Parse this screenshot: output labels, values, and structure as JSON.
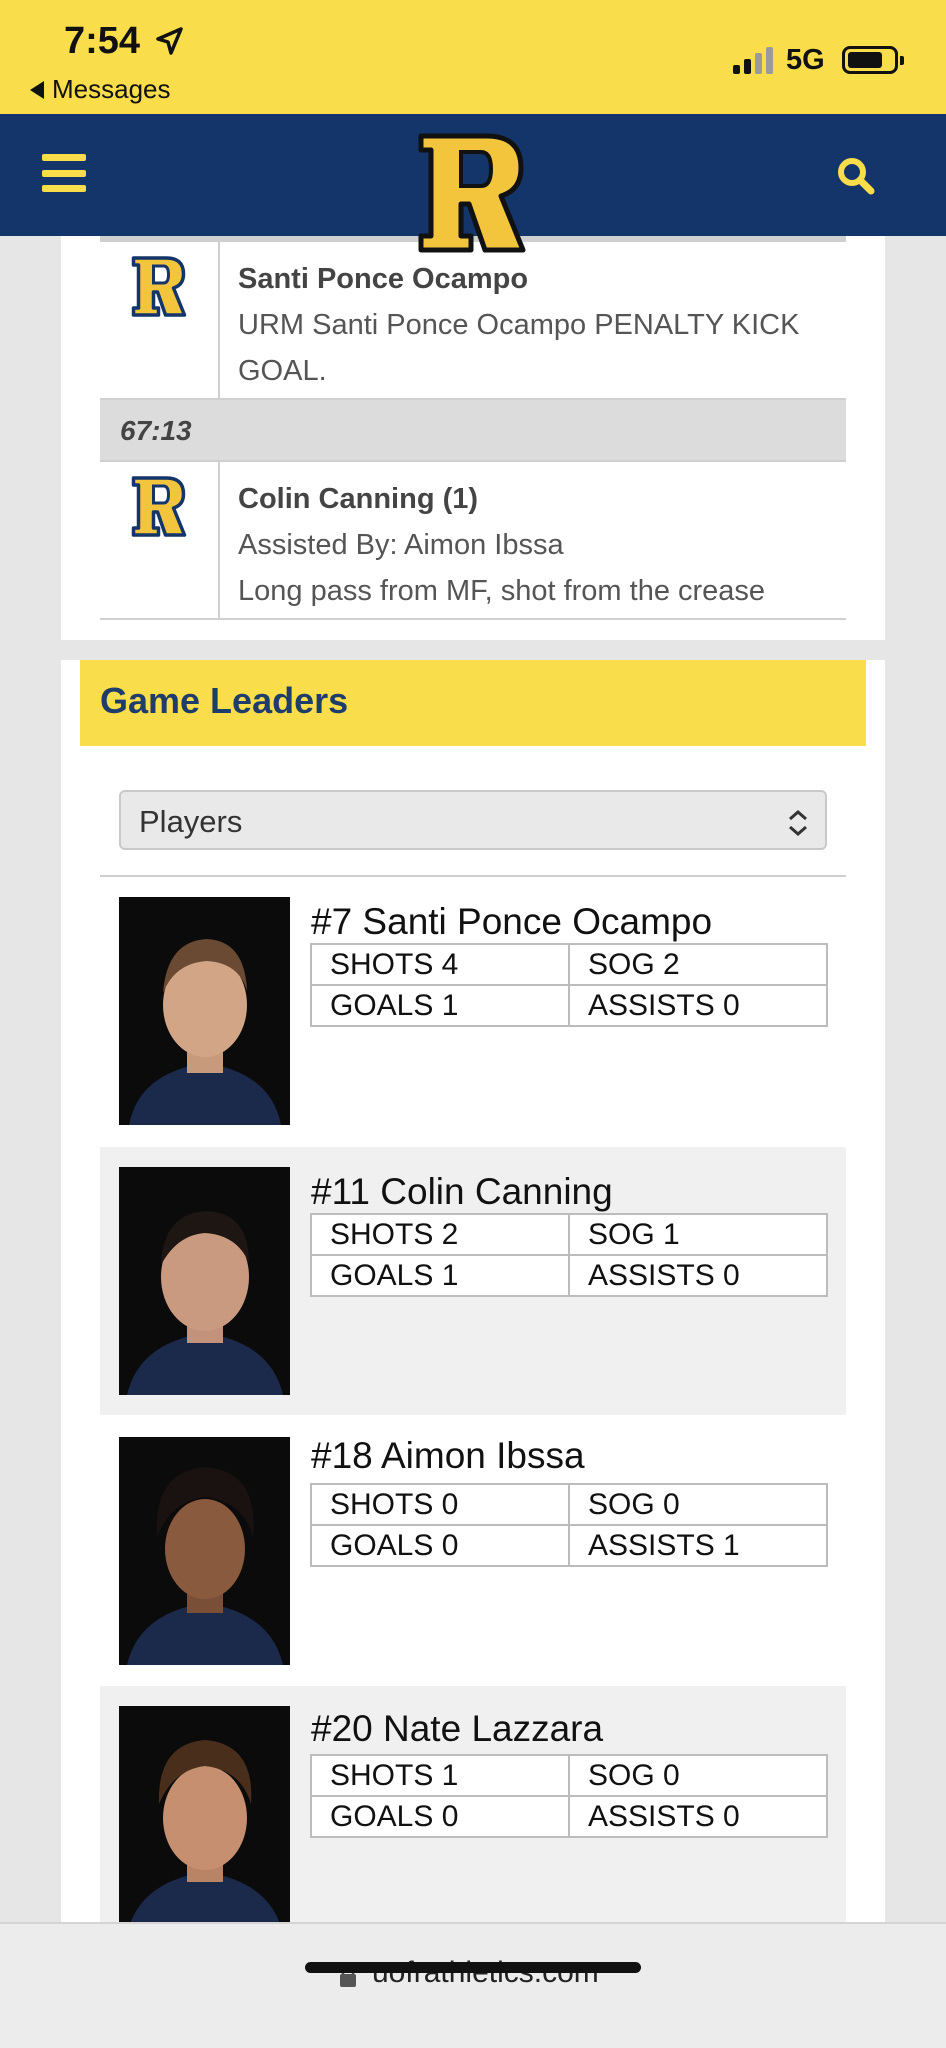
{
  "status_bar": {
    "time": "7:54",
    "back_label": "Messages",
    "network": "5G"
  },
  "header": {
    "logo_letter": "R"
  },
  "events": [
    {
      "player": "Santi Ponce Ocampo",
      "lines": [
        "URM Santi Ponce Ocampo PENALTY KICK",
        "GOAL."
      ]
    },
    {
      "time": "67:13",
      "player": "Colin Canning (1)",
      "lines": [
        "Assisted By: Aimon Ibssa",
        "Long pass from MF, shot from the crease"
      ]
    }
  ],
  "leaders": {
    "title": "Game Leaders",
    "select_value": "Players",
    "players": [
      {
        "name": "#7 Santi Ponce Ocampo",
        "shots": "SHOTS 4",
        "sog": "SOG 2",
        "goals": "GOALS 1",
        "assists": "ASSISTS 0"
      },
      {
        "name": "#11 Colin Canning",
        "shots": "SHOTS 2",
        "sog": "SOG 1",
        "goals": "GOALS 1",
        "assists": "ASSISTS 0"
      },
      {
        "name": "#18 Aimon Ibssa",
        "shots": "SHOTS 0",
        "sog": "SOG 0",
        "goals": "GOALS 0",
        "assists": "ASSISTS 1"
      },
      {
        "name": "#20 Nate Lazzara",
        "shots": "SHOTS 1",
        "sog": "SOG 0",
        "goals": "GOALS 0",
        "assists": "ASSISTS 0"
      }
    ]
  },
  "browser": {
    "url": "uofrathletics.com"
  },
  "colors": {
    "brand_yellow": "#f9dd4a",
    "brand_navy": "#13356a"
  },
  "icons": [
    "location-arrow-icon",
    "back-triangle-icon",
    "signal-icon",
    "battery-icon",
    "hamburger-menu-icon",
    "search-icon",
    "team-logo-icon",
    "select-arrows-icon",
    "lock-icon"
  ]
}
